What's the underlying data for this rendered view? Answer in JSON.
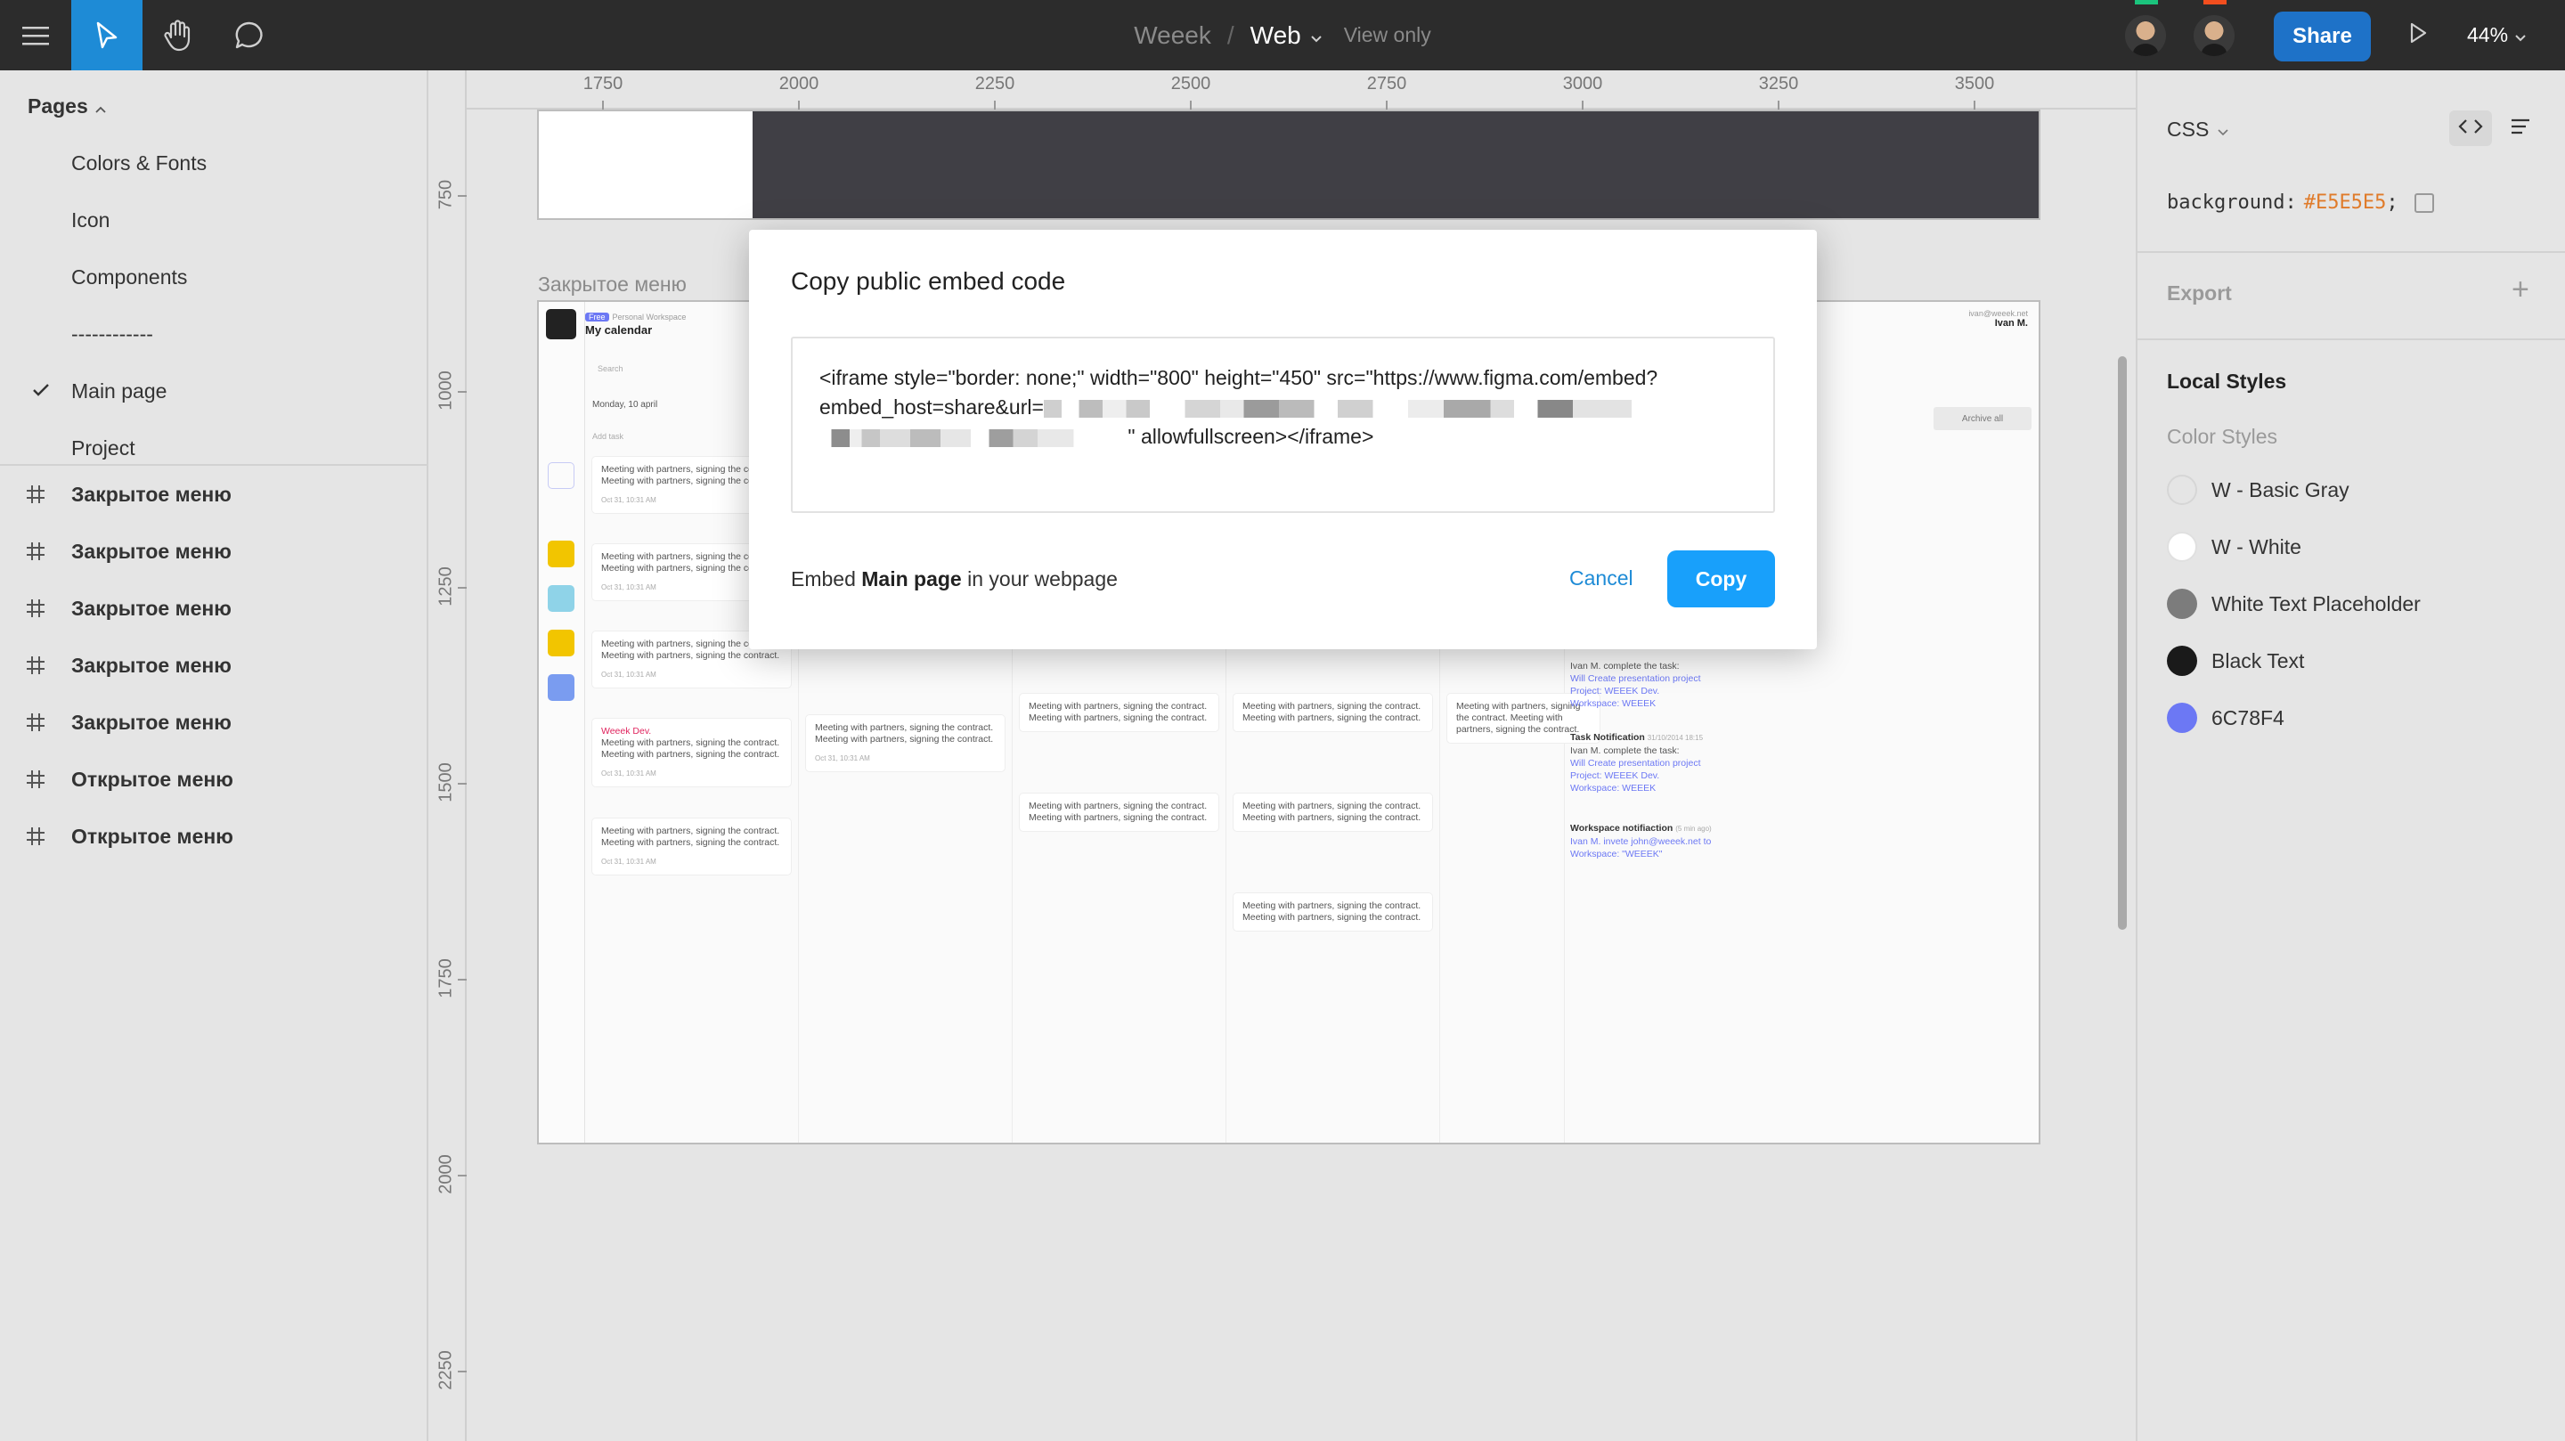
{
  "toolbar": {
    "project": "Weeek",
    "separator": "/",
    "file": "Web",
    "mode": "View only",
    "share_label": "Share",
    "zoom": "44%"
  },
  "pages": {
    "heading": "Pages",
    "items": [
      {
        "label": "Colors & Fonts"
      },
      {
        "label": "Icon"
      },
      {
        "label": "Components"
      },
      {
        "label": "------------"
      },
      {
        "label": "Main page",
        "selected": true
      },
      {
        "label": "Project"
      }
    ]
  },
  "layers": [
    {
      "label": "Закрытое меню"
    },
    {
      "label": "Закрытое меню"
    },
    {
      "label": "Закрытое меню"
    },
    {
      "label": "Закрытое меню"
    },
    {
      "label": "Закрытое меню"
    },
    {
      "label": "Открытое меню"
    },
    {
      "label": "Открытое меню"
    }
  ],
  "ruler": {
    "top": [
      "1750",
      "2000",
      "2250",
      "2500",
      "2750",
      "3000",
      "3250",
      "3500"
    ],
    "left": [
      "750",
      "1000",
      "1250",
      "1500",
      "1750",
      "2000",
      "2250"
    ]
  },
  "canvas": {
    "frame_label": "Закрытое меню",
    "app": {
      "workspace_tag": "Free",
      "workspace_name": "Personal Workspace",
      "title": "My calendar",
      "search_placeholder": "Search",
      "date": "Monday, 10 april",
      "add_task": "Add task",
      "user_email": "ivan@weeek.net",
      "user_name": "Ivan M.",
      "archive_label": "Archive all",
      "card_text": "Meeting with partners, signing the contract. Meeting with partners, signing the contract.",
      "card_time": "Oct 31, 10:31 AM",
      "tag_text": "Weeek Dev.",
      "notifications": [
        {
          "title": "",
          "lines": [
            "Ivan M. complete the task:",
            "Will Create presentation project",
            "Project: WEEEK Dev.",
            "Workspace: WEEEK"
          ]
        },
        {
          "title": "Task Notification",
          "time": "31/10/2014 18:15",
          "lines": [
            "Ivan M. complete the task:",
            "Will Create presentation project",
            "Project: WEEEK Dev.",
            "Workspace: WEEEK"
          ]
        },
        {
          "title": "Workspace notifiaction",
          "time": "(5 min ago)",
          "lines": [
            "Ivan M. invete john@weeek.net to",
            "Workspace: \"WEEEK\""
          ]
        }
      ]
    }
  },
  "inspect": {
    "mode_label": "CSS",
    "css_property": "background:",
    "css_value": "#E5E5E5",
    "css_end": ";",
    "export_label": "Export",
    "export_add": "+",
    "local_styles": "Local Styles",
    "color_styles": "Color Styles",
    "styles": [
      {
        "name": "W - Basic Gray",
        "color": "#e5e5e5"
      },
      {
        "name": "W - White",
        "color": "#ffffff"
      },
      {
        "name": "White Text Placeholder",
        "color": "#7c7c7c"
      },
      {
        "name": "Black Text",
        "color": "#1a1a1a"
      },
      {
        "name": "6C78F4",
        "color": "#6c78f4"
      }
    ]
  },
  "dialog": {
    "title": "Copy public embed code",
    "code_line1": "<iframe style=\"border: none;\" width=\"800\" height=\"450\" src=\"https://www.figma.com/embed?",
    "code_line2_prefix": "embed_host=share&url=",
    "code_line3_suffix": "\" allowfullscreen></iframe>",
    "footer_prefix": "Embed",
    "footer_page": "Main page",
    "footer_suffix": "in your webpage",
    "cancel_label": "Cancel",
    "copy_label": "Copy"
  },
  "colors": {
    "accent": "#18a0fb",
    "toolbar_bg": "#2c2c2c",
    "share_bg": "#1e72c8",
    "canvas_bg": "#e5e5e5",
    "brand_purple": "#6c78f4"
  }
}
